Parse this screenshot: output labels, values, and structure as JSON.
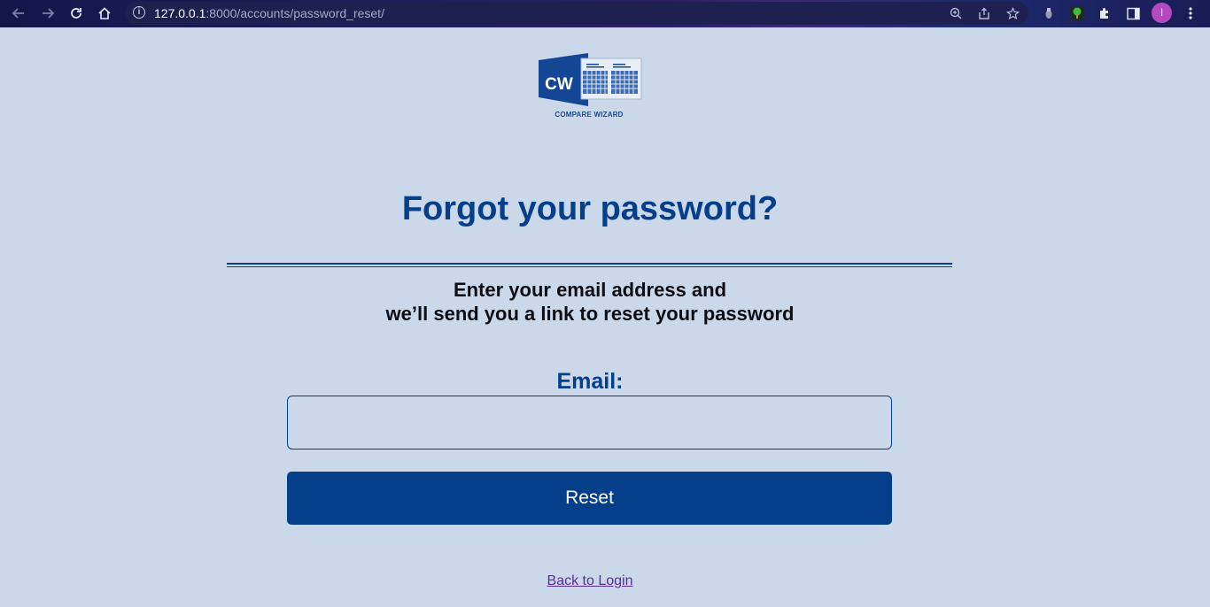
{
  "browser": {
    "url_host": "127.0.0.1",
    "url_rest": ":8000/accounts/password_reset/",
    "nav": {
      "back_icon": "arrow-left-icon",
      "forward_icon": "arrow-right-icon",
      "reload_icon": "reload-icon",
      "home_icon": "home-icon"
    },
    "url_icons": [
      "zoom-icon",
      "share-icon",
      "star-icon"
    ],
    "extensions": [
      "extension-1-icon",
      "extension-2-icon",
      "puzzle-icon",
      "sidepanel-icon"
    ],
    "profile_initial": "I",
    "menu_icon": "kebab-menu-icon",
    "colors": {
      "frame": "#15164a",
      "profile": "#b44ac0"
    }
  },
  "logo": {
    "mark_text": "CW",
    "caption": "COMPARE WIZARD",
    "color": "#1a4a96"
  },
  "page": {
    "title": "Forgot your password?",
    "instructions_line1": "Enter your email address and",
    "instructions_line2": "we’ll send you a link to reset your password",
    "email_label": "Email:",
    "email_value": "",
    "email_placeholder": "",
    "reset_label": "Reset",
    "back_link": "Back to Login",
    "colors": {
      "background": "#cbd8ea",
      "primary": "#063f89",
      "link": "#5a2d9c"
    }
  }
}
